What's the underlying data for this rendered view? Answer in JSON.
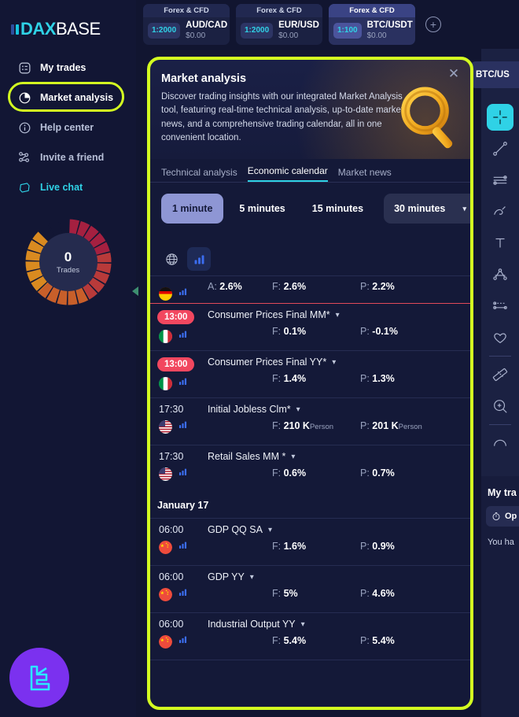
{
  "brand": {
    "part1": "DAX",
    "part2": "BASE"
  },
  "sidebar": {
    "items": [
      {
        "label": "My trades",
        "icon": "trades-icon"
      },
      {
        "label": "Market analysis",
        "icon": "pie-chart-icon"
      },
      {
        "label": "Help center",
        "icon": "info-icon"
      },
      {
        "label": "Invite a friend",
        "icon": "people-icon"
      },
      {
        "label": "Live chat",
        "icon": "chat-icon"
      }
    ],
    "donut": {
      "value": "0",
      "label": "Trades"
    }
  },
  "topbar": {
    "symbols": [
      {
        "category": "Forex & CFD",
        "leverage": "1:2000",
        "pair": "AUD/CAD",
        "amount": "$0.00",
        "selected": false
      },
      {
        "category": "Forex & CFD",
        "leverage": "1:2000",
        "pair": "EUR/USD",
        "amount": "$0.00",
        "selected": false
      },
      {
        "category": "Forex & CFD",
        "leverage": "1:100",
        "pair": "BTC/USDT",
        "amount": "$0.00",
        "selected": true
      }
    ],
    "add_label": "+"
  },
  "right_rail": {
    "pair_chip": "BTC/US",
    "tools": [
      "crosshair-icon",
      "trendline-icon",
      "horizontal-lines-icon",
      "brush-icon",
      "text-icon",
      "pitchfork-icon",
      "fib-levels-icon",
      "heart-icon",
      "ruler-icon",
      "zoom-in-icon",
      "arc-icon"
    ],
    "my_trades": {
      "title": "My tra",
      "button": "Op",
      "note": "You ha"
    }
  },
  "modal": {
    "title": "Market analysis",
    "description": "Discover trading insights with our integrated Market Analysis tool, featuring real-time technical analysis, up-to-date market news, and a comprehensive trading calendar, all in one convenient location.",
    "close_label": "✕",
    "tabs": [
      {
        "label": "Technical analysis",
        "active": false
      },
      {
        "label": "Economic calendar",
        "active": true
      },
      {
        "label": "Market news",
        "active": false
      }
    ],
    "timeframes": [
      {
        "label": "1 minute",
        "selected": true
      },
      {
        "label": "5 minutes",
        "selected": false
      },
      {
        "label": "15 minutes",
        "selected": false
      }
    ],
    "timeframe_select": {
      "value": "30 minutes",
      "caret": "▾"
    },
    "view_buttons": [
      {
        "icon": "globe-icon",
        "active": false
      },
      {
        "icon": "bar-chart-icon",
        "active": true
      }
    ]
  },
  "calendar": {
    "labels": {
      "actual": "A:",
      "forecast": "F:",
      "previous": "P:"
    },
    "rows": [
      {
        "type": "event",
        "partial": true,
        "red_underline": true,
        "time": "",
        "time_badge": false,
        "flag": "de",
        "name": "",
        "actual": "2.6%",
        "forecast": "2.6%",
        "previous": "2.2%",
        "actual_unit": "",
        "forecast_unit": "",
        "previous_unit": ""
      },
      {
        "type": "event",
        "partial": false,
        "red_underline": false,
        "time": "13:00",
        "time_badge": true,
        "flag": "it",
        "name": "Consumer Prices Final MM*",
        "actual": "",
        "forecast": "0.1%",
        "previous": "-0.1%",
        "actual_unit": "",
        "forecast_unit": "",
        "previous_unit": ""
      },
      {
        "type": "event",
        "partial": false,
        "red_underline": false,
        "time": "13:00",
        "time_badge": true,
        "flag": "it",
        "name": "Consumer Prices Final YY*",
        "actual": "",
        "forecast": "1.4%",
        "previous": "1.3%",
        "actual_unit": "",
        "forecast_unit": "",
        "previous_unit": ""
      },
      {
        "type": "event",
        "partial": false,
        "red_underline": false,
        "time": "17:30",
        "time_badge": false,
        "flag": "us",
        "name": "Initial Jobless Clm*",
        "actual": "",
        "forecast": "210 K",
        "previous": "201 K",
        "actual_unit": "",
        "forecast_unit": "Person",
        "previous_unit": "Person"
      },
      {
        "type": "event",
        "partial": false,
        "red_underline": false,
        "time": "17:30",
        "time_badge": false,
        "flag": "us",
        "name": "Retail Sales MM *",
        "actual": "",
        "forecast": "0.6%",
        "previous": "0.7%",
        "actual_unit": "",
        "forecast_unit": "",
        "previous_unit": ""
      },
      {
        "type": "date",
        "label": "January 17"
      },
      {
        "type": "event",
        "partial": false,
        "red_underline": false,
        "time": "06:00",
        "time_badge": false,
        "flag": "cn",
        "name": "GDP QQ SA",
        "actual": "",
        "forecast": "1.6%",
        "previous": "0.9%",
        "actual_unit": "",
        "forecast_unit": "",
        "previous_unit": ""
      },
      {
        "type": "event",
        "partial": false,
        "red_underline": false,
        "time": "06:00",
        "time_badge": false,
        "flag": "cn",
        "name": "GDP YY",
        "actual": "",
        "forecast": "5%",
        "previous": "4.6%",
        "actual_unit": "",
        "forecast_unit": "",
        "previous_unit": ""
      },
      {
        "type": "event",
        "partial": false,
        "red_underline": false,
        "time": "06:00",
        "time_badge": false,
        "flag": "cn",
        "name": "Industrial Output YY",
        "actual": "",
        "forecast": "5.4%",
        "previous": "5.4%",
        "actual_unit": "",
        "forecast_unit": "",
        "previous_unit": ""
      }
    ]
  },
  "colors": {
    "highlight": "#d4ff21",
    "accent": "#2fd2e6",
    "badge_red": "#f2475f",
    "avatar_purple": "#7b31ef"
  }
}
